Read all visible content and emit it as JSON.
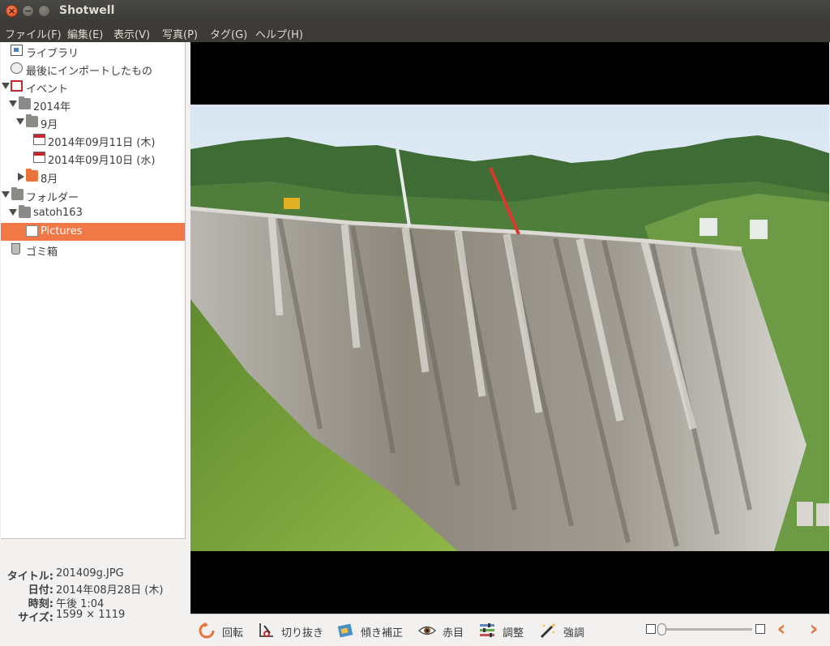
{
  "window": {
    "title": "Shotwell"
  },
  "menubar": {
    "items": [
      "ファイル(F)",
      "編集(E)",
      "表示(V)",
      "写真(P)",
      "タグ(G)",
      "ヘルプ(H)"
    ]
  },
  "sidebar": {
    "library": "ライブラリ",
    "last_import": "最後にインポートしたもの",
    "events": "イベント",
    "year_2014": "2014年",
    "month_9": "9月",
    "day_0911": "2014年09月11日 (木)",
    "day_0910": "2014年09月10日 (水)",
    "month_8": "8月",
    "folders": "フォルダー",
    "folder_user": "satoh163",
    "folder_pictures": "Pictures",
    "trash": "ゴミ箱"
  },
  "properties": {
    "title_key": "タイトル:",
    "title_val": "201409g.JPG",
    "date_key": "日付:",
    "date_val": "2014年08月28日 (木)",
    "time_key": "時刻:",
    "time_val": "午後 1:04",
    "size_key": "サイズ:",
    "size_val": "1599 × 1119"
  },
  "toolbar": {
    "rotate": "回転",
    "crop": "切り抜き",
    "straighten": "傾き補正",
    "redeye": "赤目",
    "adjust": "調整",
    "enhance": "強調",
    "zoom_level": 0,
    "prev": "‹",
    "next": "›"
  },
  "colors": {
    "selection": "#f07746",
    "titlebar": "#3c3b37",
    "accent_orange": "#e8743b"
  }
}
